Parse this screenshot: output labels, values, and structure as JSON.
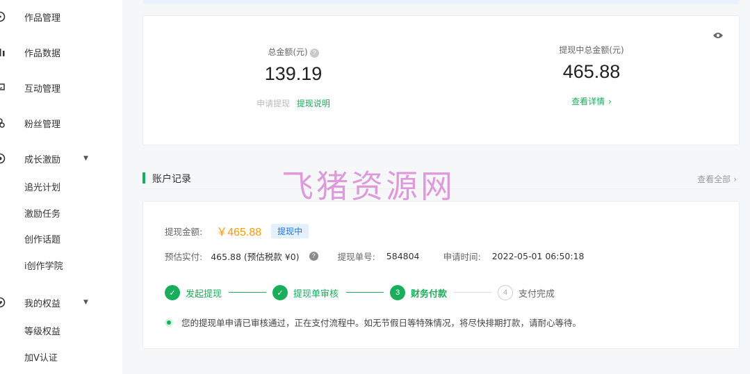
{
  "sidebar": {
    "items": [
      {
        "label": "作品管理",
        "icon": "play-icon"
      },
      {
        "label": "作品数据",
        "icon": "bar-chart-icon"
      },
      {
        "label": "互动管理",
        "icon": "chat-icon"
      },
      {
        "label": "粉丝管理",
        "icon": "fans-icon"
      },
      {
        "label": "成长激励",
        "icon": "growth-icon"
      },
      {
        "label": "我的权益",
        "icon": "heart-shield-icon"
      }
    ],
    "growth_sub": [
      "追光计划",
      "激励任务",
      "创作话题",
      "i创作学院"
    ],
    "rights_sub": [
      "等级权益",
      "加V认证"
    ]
  },
  "summary": {
    "total_label": "总金额(元)",
    "total_value": "139.19",
    "apply_label": "申请提现",
    "explain_label": "提现说明",
    "pending_label": "提现中总金额(元)",
    "pending_value": "465.88",
    "details_label": "查看详情"
  },
  "records": {
    "title": "账户记录",
    "view_all": "查看全部",
    "amount_label": "提现金额:",
    "amount_value": "￥465.88",
    "status_badge": "提现中",
    "actual_label": "预估实付:",
    "actual_value": "465.88 (预估税款 ¥0)",
    "order_label": "提现单号:",
    "order_value": "584804",
    "time_label": "申请时间:",
    "time_value": "2022-05-01 06:50:18",
    "steps": [
      {
        "label": "发起提现",
        "state": "done"
      },
      {
        "label": "提现单审核",
        "state": "done"
      },
      {
        "label": "财务付款",
        "state": "current",
        "num": "3"
      },
      {
        "label": "支付完成",
        "state": "todo",
        "num": "4"
      }
    ],
    "notice": "您的提现单申请已审核通过，正在支付流程中。如无节假日等特殊情况，将尽快排期打款，请耐心等待。"
  },
  "watermark": "飞猪资源网",
  "colors": {
    "accent": "#1aad5b",
    "amount": "#ff9900",
    "badge": "#1e76e1",
    "watermark": "#d98bd6"
  }
}
